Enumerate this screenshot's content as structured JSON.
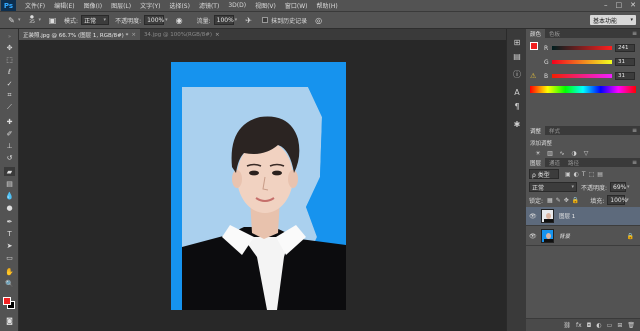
{
  "app": {
    "logo": "Ps"
  },
  "menu": [
    "文件(F)",
    "编辑(E)",
    "图像(I)",
    "图层(L)",
    "文字(Y)",
    "选择(S)",
    "滤镜(T)",
    "3D(D)",
    "视图(V)",
    "窗口(W)",
    "帮助(H)"
  ],
  "window_controls": [
    "–",
    "□",
    "✕"
  ],
  "options": {
    "brush_size": "35",
    "mode_label": "模式:",
    "mode_value": "正常",
    "opacity_label": "不透明度:",
    "opacity_value": "100%",
    "flow_label": "流量:",
    "flow_value": "100%",
    "history_label": "抹到历史记录",
    "workspace": "基本功能"
  },
  "tabs": [
    {
      "label": "正装照.jpg @ 66.7% (图层 1, RGB/8#) *",
      "active": true
    },
    {
      "label": "34.jpg @ 100%(RGB/8#)",
      "active": false
    }
  ],
  "color_panel": {
    "tabs": [
      "颜色",
      "色板"
    ],
    "r_label": "R",
    "r_value": "241",
    "g_label": "G",
    "g_value": "31",
    "b_label": "B",
    "b_value": "31",
    "fg_color": "#f11f1f",
    "accent": "#1693ee"
  },
  "adjustments": {
    "tabs": [
      "调整",
      "样式"
    ],
    "title": "添加调整"
  },
  "layers_panel": {
    "tabs": [
      "图层",
      "通道",
      "路径"
    ],
    "kind_label": "ρ 类型",
    "blend_mode": "正常",
    "opacity_label": "不透明度:",
    "opacity_value": "69%",
    "lock_label": "锁定:",
    "fill_label": "填充:",
    "fill_value": "100%",
    "layers": [
      {
        "name": "图层 1",
        "selected": true
      },
      {
        "name": "背景",
        "selected": false
      }
    ]
  }
}
